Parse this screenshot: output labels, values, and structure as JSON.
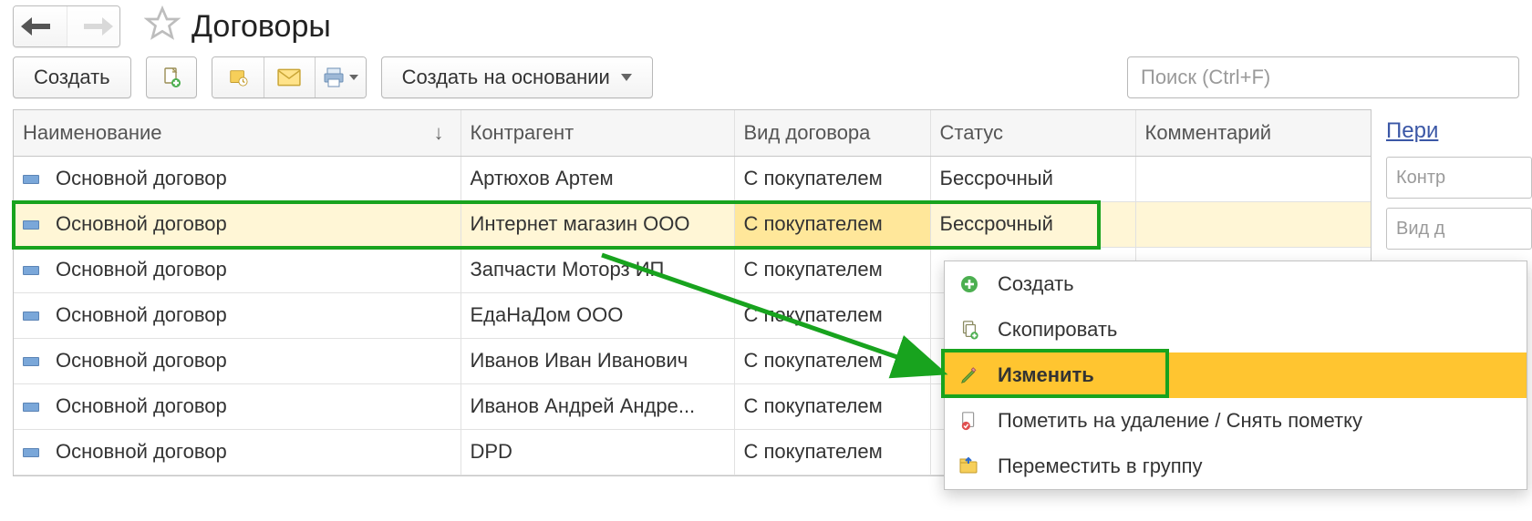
{
  "header": {
    "title": "Договоры"
  },
  "toolbar": {
    "create_label": "Создать",
    "create_based_on_label": "Создать на основании",
    "search_placeholder": "Поиск (Ctrl+F)"
  },
  "table": {
    "columns": {
      "name": "Наименование",
      "counterparty": "Контрагент",
      "kind": "Вид договора",
      "status": "Статус",
      "comment": "Комментарий"
    },
    "rows": [
      {
        "name": "Основной договор",
        "counterparty": "Артюхов Артем",
        "kind": "С покупателем",
        "status": "Бессрочный",
        "comment": ""
      },
      {
        "name": "Основной договор",
        "counterparty": "Интернет магазин ООО",
        "kind": "С покупателем",
        "status": "Бессрочный",
        "comment": "",
        "selected": true
      },
      {
        "name": "Основной договор",
        "counterparty": "Запчасти Моторз ИП",
        "kind": "С покупателем",
        "status": "",
        "comment": ""
      },
      {
        "name": "Основной договор",
        "counterparty": "ЕдаНаДом ООО",
        "kind": "С покупателем",
        "status": "",
        "comment": ""
      },
      {
        "name": "Основной договор",
        "counterparty": "Иванов Иван Иванович",
        "kind": "С покупателем",
        "status": "",
        "comment": ""
      },
      {
        "name": "Основной договор",
        "counterparty": "Иванов Андрей Андре...",
        "kind": "С покупателем",
        "status": "",
        "comment": ""
      },
      {
        "name": "Основной договор",
        "counterparty": "DPD",
        "kind": "С покупателем",
        "status": "",
        "comment": ""
      }
    ]
  },
  "side_panel": {
    "period_label": "Пери",
    "counterparty_placeholder": "Контр",
    "kind_placeholder": "Вид д"
  },
  "context_menu": {
    "items": [
      {
        "icon": "plus",
        "label": "Создать"
      },
      {
        "icon": "copy",
        "label": "Скопировать"
      },
      {
        "icon": "pencil",
        "label": "Изменить",
        "highlight": true
      },
      {
        "icon": "delete",
        "label": "Пометить на удаление / Снять пометку"
      },
      {
        "icon": "folder",
        "label": "Переместить в группу"
      }
    ]
  }
}
